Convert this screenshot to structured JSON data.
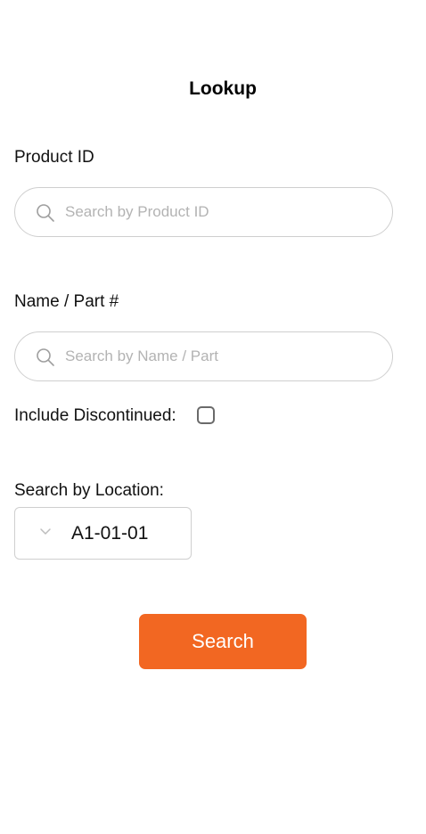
{
  "header": {
    "title": "Lookup"
  },
  "product_id": {
    "label": "Product ID",
    "placeholder": "Search by Product ID",
    "value": "",
    "icon": "search-icon"
  },
  "name_part": {
    "label": "Name / Part #",
    "placeholder": "Search by Name / Part",
    "value": "",
    "icon": "search-icon"
  },
  "discontinued": {
    "label": "Include Discontinued:",
    "checked": false
  },
  "location": {
    "label": "Search by Location:",
    "selected": "A1-01-01",
    "icon": "chevron-down-icon"
  },
  "actions": {
    "search_label": "Search"
  },
  "colors": {
    "accent": "#f26722",
    "border": "#cfcfcf",
    "placeholder": "#b3b3b3"
  }
}
